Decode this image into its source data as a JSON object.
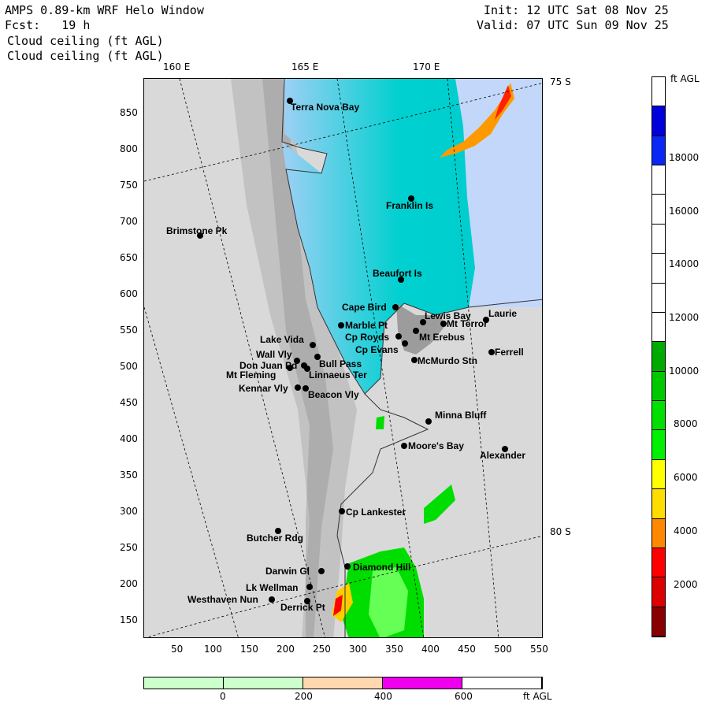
{
  "header": {
    "title": "AMPS 0.89-km WRF Helo Window",
    "fcst": "Fcst:   19 h",
    "field1": "Cloud ceiling (ft AGL)",
    "field2": "Cloud ceiling (ft AGL)",
    "init": "Init: 12 UTC Sat 08 Nov 25",
    "valid": "Valid: 07 UTC Sun 09 Nov 25"
  },
  "map": {
    "lon_labels": [
      "160 E",
      "165 E",
      "170 E"
    ],
    "lat_labels": [
      "75 S",
      "80 S"
    ],
    "x_ticks": [
      "50",
      "100",
      "150",
      "200",
      "250",
      "300",
      "350",
      "400",
      "450",
      "500",
      "550"
    ],
    "y_ticks": [
      "850",
      "800",
      "750",
      "700",
      "650",
      "600",
      "550",
      "500",
      "450",
      "400",
      "350",
      "300",
      "250",
      "200",
      "150"
    ],
    "places": [
      "Terra Nova Bay",
      "Franklin Is",
      "Brimstone Pk",
      "Beaufort Is",
      "Cape Bird",
      "Lewis Bay",
      "Laurie",
      "Marble Pt",
      "Mt Terror",
      "Cp Royds",
      "Mt Erebus",
      "Lake Vida",
      "Cp Evans",
      "Ferrell",
      "Wall Vly",
      "Bull Pass",
      "McMurdo Stn",
      "Don Juan Pd",
      "Mt Fleming",
      "Linnaeus Ter",
      "Kennar Vly",
      "Beacon Vly",
      "Minna Bluff",
      "Moore's Bay",
      "Alexander",
      "Cp Lankester",
      "Butcher Rdg",
      "Darwin Gl",
      "Diamond Hill",
      "Lk Wellman",
      "Westhaven Nun",
      "Derrick Pt"
    ]
  },
  "colorbar": {
    "unit": "ft AGL",
    "labels": [
      "18000",
      "16000",
      "14000",
      "12000",
      "10000",
      "8000",
      "6000",
      "4000",
      "2000"
    ],
    "colors": [
      "#ffffff",
      "#0000dd",
      "#0a28f5",
      "#ffffff",
      "#ffffff",
      "#ffffff",
      "#ffffff",
      "#ffffff",
      "#ffffff",
      "#00aa00",
      "#00c800",
      "#00e000",
      "#00f000",
      "#ffff00",
      "#ffdd00",
      "#ff8800",
      "#ff0000",
      "#dd0000",
      "#880000"
    ]
  },
  "terrain_bar": {
    "labels": [
      "0",
      "200",
      "400",
      "600"
    ],
    "unit": "ft AGL",
    "colors": [
      "#ccffcc",
      "#ccffcc",
      "#ffd8b0",
      "#ee00ee",
      "#ffffff"
    ]
  },
  "legend_colors": {
    "sea_ice": "#00d0d0",
    "lavender": "#d8d8ff",
    "terrain": "#d8d8d8"
  }
}
